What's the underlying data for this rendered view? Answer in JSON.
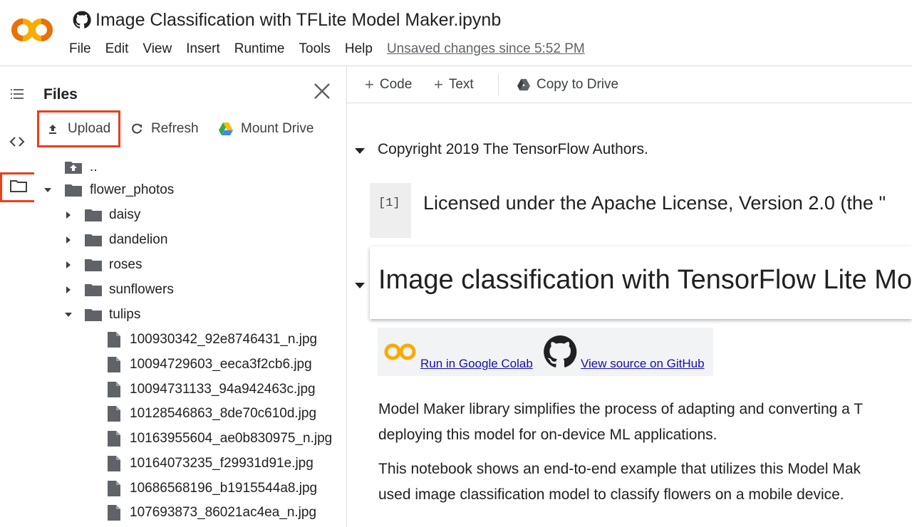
{
  "header": {
    "title": "Image Classification with TFLite Model Maker.ipynb",
    "menu": [
      "File",
      "Edit",
      "View",
      "Insert",
      "Runtime",
      "Tools",
      "Help"
    ],
    "unsaved": "Unsaved changes since 5:52 PM",
    "logo_text": "CO"
  },
  "files_panel": {
    "title": "Files",
    "actions": {
      "upload": "Upload",
      "refresh": "Refresh",
      "mount": "Mount Drive"
    },
    "tree": {
      "parent": "..",
      "root": "flower_photos",
      "folders": [
        "daisy",
        "dandelion",
        "roses",
        "sunflowers",
        "tulips"
      ],
      "tulip_files": [
        "100930342_92e8746431_n.jpg",
        "10094729603_eeca3f2cb6.jpg",
        "10094731133_94a942463c.jpg",
        "10128546863_8de70c610d.jpg",
        "10163955604_ae0b830975_n.jpg",
        "10164073235_f29931d91e.jpg",
        "10686568196_b1915544a8.jpg",
        "107693873_86021ac4ea_n.jpg"
      ]
    }
  },
  "toolbar": {
    "code": "Code",
    "text": "Text",
    "copy": "Copy to Drive"
  },
  "notebook": {
    "section1_title": "Copyright 2019 The TensorFlow Authors.",
    "cell_count": "[1]",
    "cell_text": "Licensed under the Apache License, Version 2.0 (the \"",
    "section2_title": "Image classification with TensorFlow Lite Mo",
    "badge_colab": "Run in Google Colab",
    "badge_github": "View source on GitHub",
    "para1_line1": "Model Maker library simplifies the process of adapting and converting a T",
    "para1_line2": "deploying this model for on-device ML applications.",
    "para2_line1": "This notebook shows an end-to-end example that utilizes this Model Mak",
    "para2_line2": "used image classification model to classify flowers on a mobile device."
  },
  "colors": {
    "highlight": "#e8401c",
    "logo_yellow": "#f9ab00",
    "logo_orange": "#e8710a",
    "link": "#1a0dab"
  },
  "icons": {
    "toc": "list-icon",
    "code": "code-brackets-icon",
    "files": "folder-outline-icon",
    "close": "close-icon",
    "upload": "upload-icon",
    "refresh": "refresh-icon",
    "drive": "google-drive-icon",
    "file": "file-icon",
    "folder": "folder-icon"
  }
}
